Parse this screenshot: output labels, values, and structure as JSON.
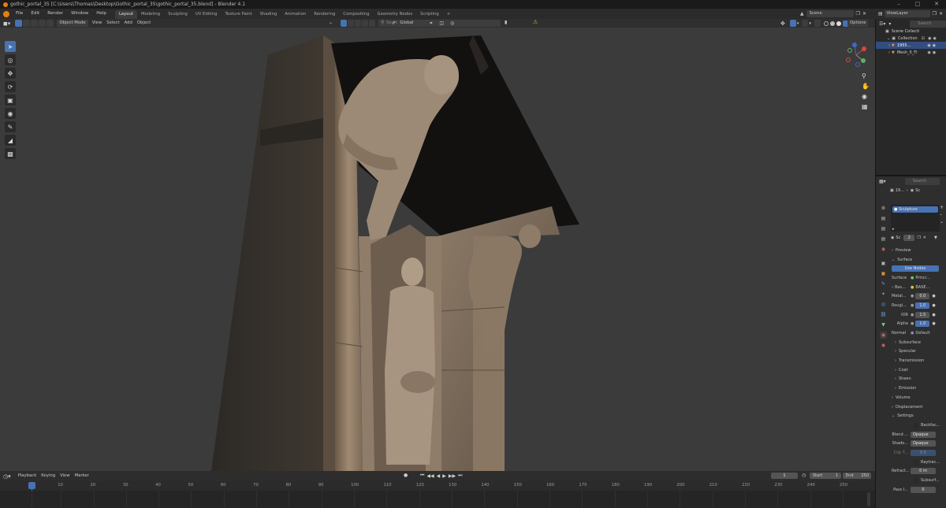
{
  "window": {
    "title": "gothic_portal_35 [C:\\Users\\Thomas\\Desktop\\Gothic_portal_35\\gothic_portal_35.blend] - Blender 4.1"
  },
  "menubar": {
    "menus": [
      "File",
      "Edit",
      "Render",
      "Window",
      "Help"
    ],
    "workspaces": [
      "Layout",
      "Modeling",
      "Sculpting",
      "UV Editing",
      "Texture Paint",
      "Shading",
      "Animation",
      "Rendering",
      "Compositing",
      "Geometry Nodes",
      "Scripting"
    ],
    "add_tab": "+",
    "scene_label": "Scene",
    "view_layer_label": "ViewLayer"
  },
  "viewport_header": {
    "mode": "Object Mode",
    "menus": [
      "View",
      "Select",
      "Add",
      "Object"
    ],
    "orientation": "Global",
    "search_placeholder": "Search",
    "options_label": "Options"
  },
  "outliner": {
    "search_placeholder": "Search",
    "items": [
      {
        "label": "Scene Collecti"
      },
      {
        "label": "Collection"
      },
      {
        "label": "1955..."
      },
      {
        "label": "Mesh_0_Fl"
      }
    ]
  },
  "properties": {
    "search_placeholder": "Search",
    "breadcrumb_a": "19...",
    "breadcrumb_b": "Sc",
    "material_slot": "Sculpture",
    "datablock_name": "Sc",
    "datablock_users": "2",
    "sections": {
      "preview": "Preview",
      "surface": "Surface",
      "use_nodes": "Use Nodes",
      "surface_label": "Surface",
      "surface_value": "Princi...",
      "base_label": "Bas...",
      "base_value": "BASE...",
      "metal_label": "Metal...",
      "metal_value": "0.0",
      "rough_label": "Rougi...",
      "rough_value": "1.0",
      "ior_label": "IOR",
      "ior_value": "1.5",
      "alpha_label": "Alpha",
      "alpha_value": "1.0",
      "normal_label": "Normal",
      "normal_value": "Default",
      "subsurface": "Subsurface",
      "specular": "Specular",
      "transmission": "Transmission",
      "coat": "Coat",
      "sheen": "Sheen",
      "emission": "Emission",
      "volume": "Volume",
      "displacement": "Displacement",
      "settings": "Settings",
      "backface": "Backfac...",
      "blend_label": "Blend ...",
      "blend_value": "Opaque",
      "shadow_label": "Shado...",
      "shadow_value": "Opaque",
      "clip_label": "Clip T...",
      "clip_value": "0.5",
      "raytrace": "Raytrac...",
      "refract_label": "Refract...",
      "refract_value": "0 m",
      "subsurf": "Subsurf...",
      "pass_label": "Pass I...",
      "pass_value": "0"
    }
  },
  "timeline": {
    "menus": [
      "Playback",
      "Keying",
      "View",
      "Marker"
    ],
    "current_frame": "1",
    "start_label": "Start",
    "start_value": "1",
    "end_label": "End",
    "end_value": "250",
    "ticks": [
      "1",
      "10",
      "20",
      "30",
      "40",
      "50",
      "60",
      "70",
      "80",
      "90",
      "100",
      "110",
      "120",
      "130",
      "140",
      "150",
      "160",
      "170",
      "180",
      "190",
      "200",
      "210",
      "220",
      "230",
      "240",
      "250"
    ]
  },
  "colors": {
    "accent": "#4772b3",
    "viewport_bg": "#3b3b3b",
    "panel_bg": "#2e2e2e"
  }
}
